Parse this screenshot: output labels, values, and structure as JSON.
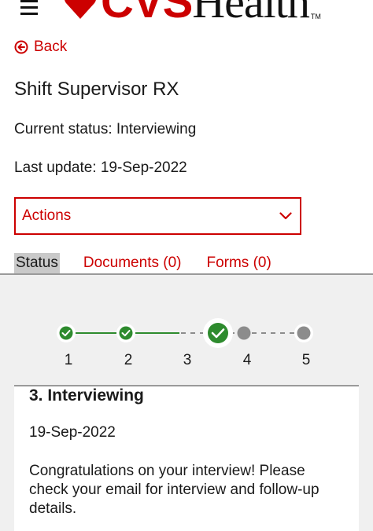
{
  "header": {
    "menu_icon": "hamburger-menu-icon",
    "logo_brand": "CVS",
    "logo_health": "Health",
    "logo_tm": "TM",
    "brand_color": "#cc0000"
  },
  "back": {
    "label": "Back",
    "icon": "arrow-left-circle-icon"
  },
  "job": {
    "title": "Shift Supervisor RX",
    "current_status": "Current status: Interviewing",
    "last_update": "Last update: 19-Sep-2022"
  },
  "actions": {
    "label": "Actions",
    "icon": "chevron-down-icon"
  },
  "tabs": [
    {
      "label": "Status",
      "active": true
    },
    {
      "label": "Documents (0)",
      "active": false
    },
    {
      "label": "Forms (0)",
      "active": false
    }
  ],
  "stepper": {
    "steps": [
      {
        "number": "1",
        "state": "complete"
      },
      {
        "number": "2",
        "state": "complete"
      },
      {
        "number": "3",
        "state": "current"
      },
      {
        "number": "4",
        "state": "pending"
      },
      {
        "number": "5",
        "state": "pending"
      }
    ],
    "complete_color": "#2e8b2e",
    "pending_color": "#8c8c8c"
  },
  "detail": {
    "title": "3. Interviewing",
    "date": "19-Sep-2022",
    "message": "Congratulations on your interview! Please check your email for interview and follow-up details."
  }
}
